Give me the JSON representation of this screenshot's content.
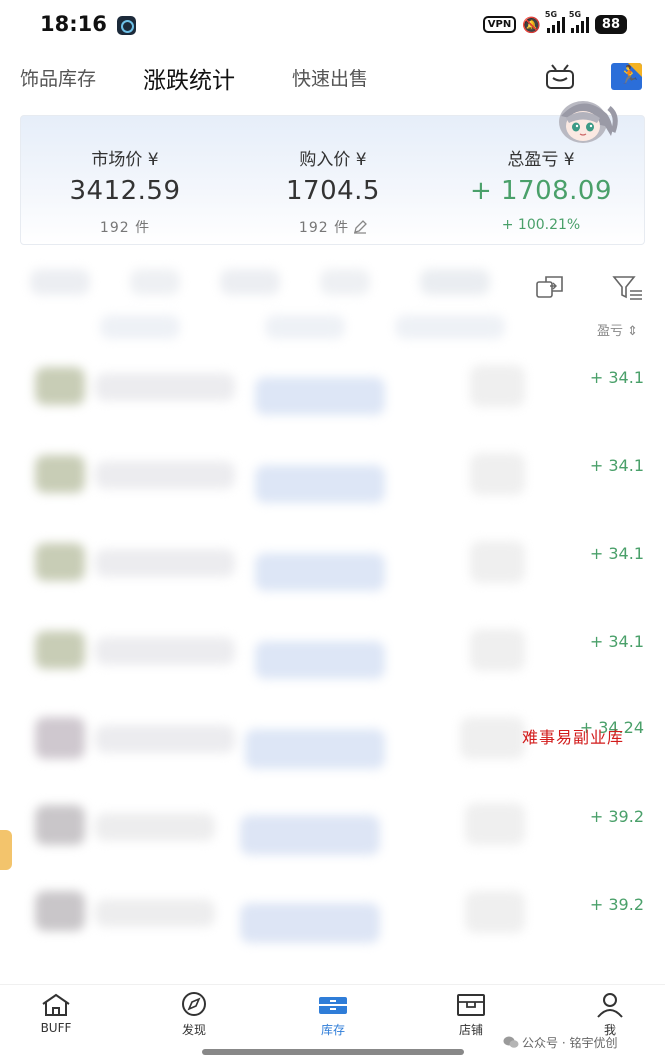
{
  "status_bar": {
    "time": "18:16",
    "vpn": "VPN",
    "network_1": "5G",
    "network_2": "5G",
    "battery": "88"
  },
  "tabs": [
    {
      "label": "饰品库存",
      "active": false
    },
    {
      "label": "涨跌统计",
      "active": true
    },
    {
      "label": "快速出售",
      "active": false
    }
  ],
  "summary": {
    "market": {
      "label": "市场价 ¥",
      "value": "3412.59",
      "sub": "192 件"
    },
    "purchase": {
      "label": "购入价 ¥",
      "value": "1704.5",
      "sub": "192 件"
    },
    "profit": {
      "label": "总盈亏 ¥",
      "value": "+ 1708.09",
      "sub": "+ 100.21%"
    }
  },
  "list": {
    "sort_header": "盈亏 ⇕",
    "rows": [
      {
        "profit": "+ 34.1"
      },
      {
        "profit": "+ 34.1"
      },
      {
        "profit": "+ 34.1"
      },
      {
        "profit": "+ 34.1"
      },
      {
        "profit": "+ 34.24"
      },
      {
        "profit": "+ 39.2"
      },
      {
        "profit": "+ 39.2"
      }
    ]
  },
  "watermark": "难事易副业库",
  "bottom_nav": [
    {
      "label": "BUFF",
      "icon": "home-icon"
    },
    {
      "label": "发现",
      "icon": "compass-icon"
    },
    {
      "label": "库存",
      "icon": "inventory-icon",
      "active": true
    },
    {
      "label": "店铺",
      "icon": "shop-icon"
    },
    {
      "label": "我",
      "icon": "user-icon"
    }
  ],
  "wechat_mark": "公众号 · 铭宇优创",
  "colors": {
    "profit_green": "#4aa06a",
    "accent_blue": "#2f7dd8",
    "watermark_red": "#d21b1b"
  }
}
